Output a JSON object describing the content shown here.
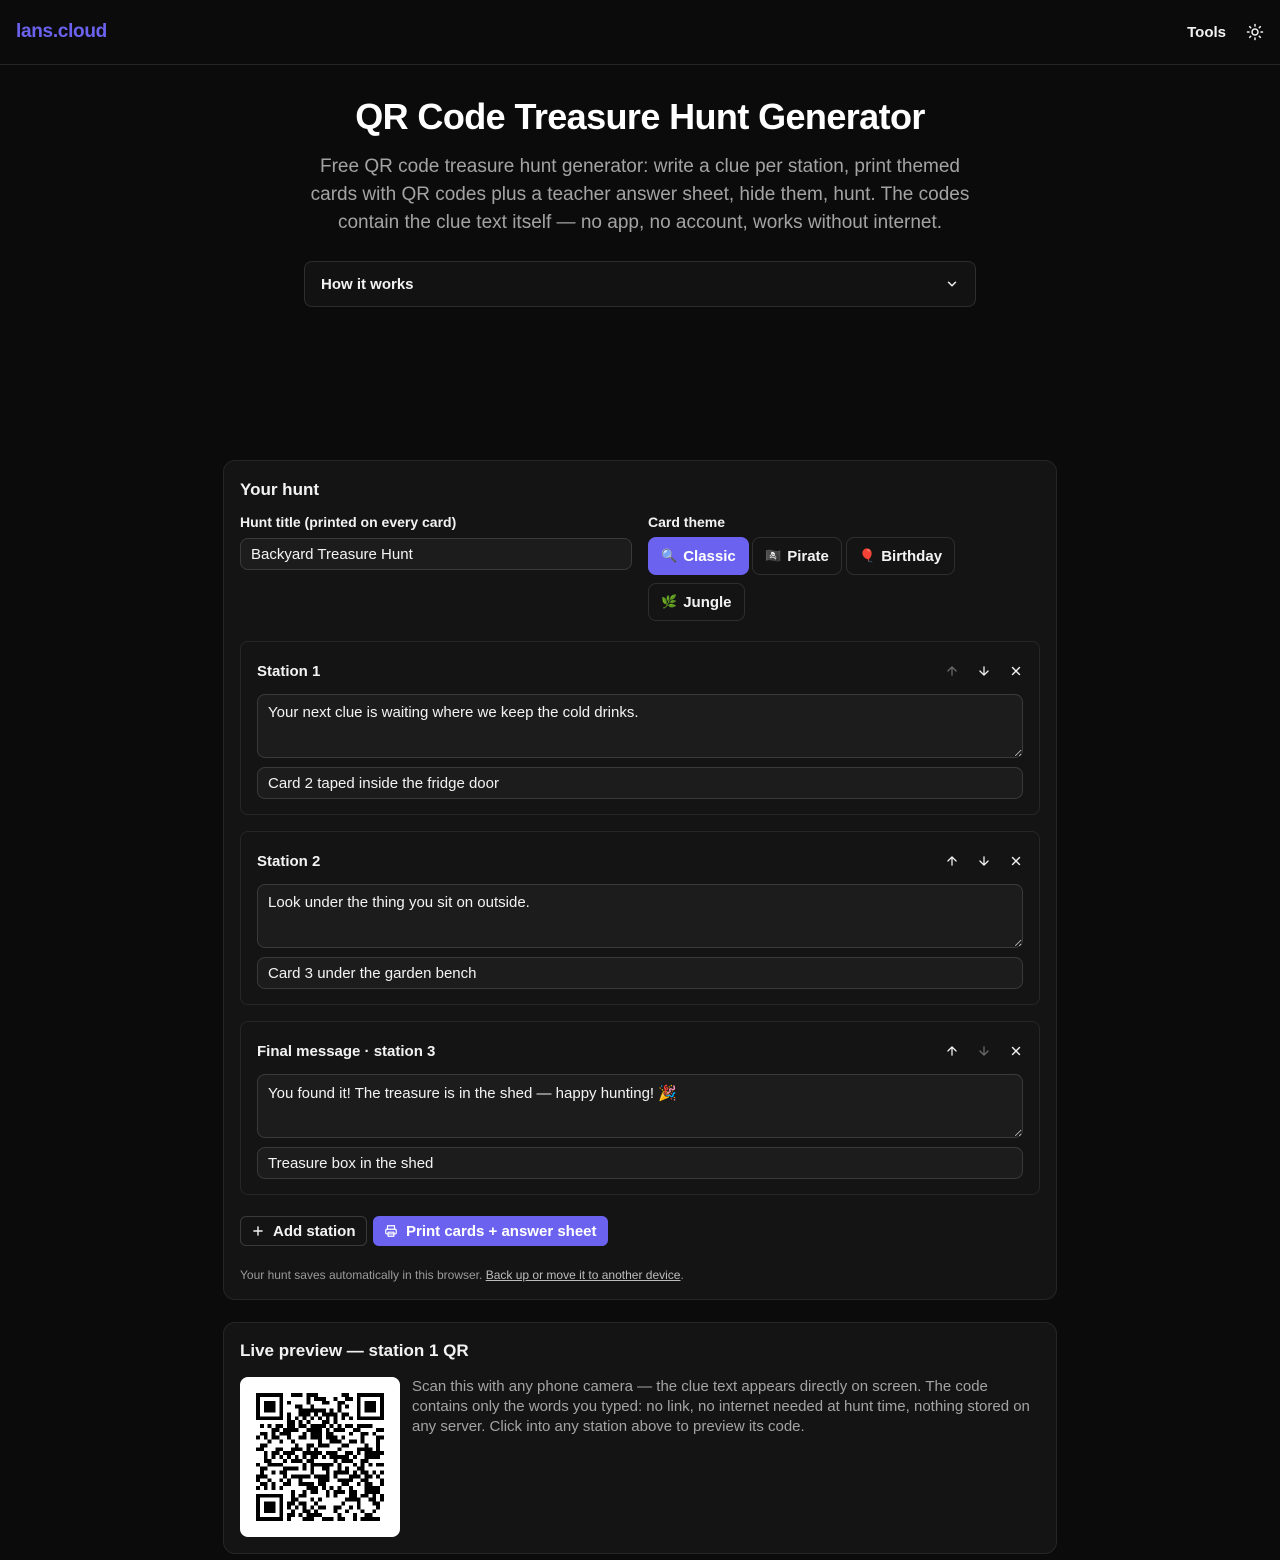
{
  "header": {
    "logo": "lans.cloud",
    "nav_tools": "Tools"
  },
  "hero": {
    "title": "QR Code Treasure Hunt Generator",
    "description": "Free QR code treasure hunt generator: write a clue per station, print themed cards with QR codes plus a teacher answer sheet, hide them, hunt. The codes contain the clue text itself — no app, no account, works without internet.",
    "how_it_works": "How it works"
  },
  "hunt": {
    "title": "Your hunt",
    "title_label": "Hunt title (printed on every card)",
    "title_value": "Backyard Treasure Hunt",
    "theme_label": "Card theme",
    "themes": [
      {
        "emoji": "🔍",
        "label": "Classic",
        "active": true
      },
      {
        "emoji": "🏴‍☠️",
        "label": "Pirate",
        "active": false
      },
      {
        "emoji": "🎈",
        "label": "Birthday",
        "active": false
      },
      {
        "emoji": "🌿",
        "label": "Jungle",
        "active": false
      }
    ],
    "stations": [
      {
        "title": "Station 1",
        "clue": "Your next clue is waiting where we keep the cold drinks.",
        "hiding_place": "Card 2 taped inside the fridge door"
      },
      {
        "title": "Station 2",
        "clue": "Look under the thing you sit on outside.",
        "hiding_place": "Card 3 under the garden bench"
      },
      {
        "title": "Final message · station 3",
        "clue": "You found it! The treasure is in the shed — happy hunting! 🎉",
        "hiding_place": "Treasure box in the shed"
      }
    ],
    "add_station": "Add station",
    "print": "Print cards + answer sheet",
    "save_note": "Your hunt saves automatically in this browser.",
    "save_link": "Back up or move it to another device",
    "save_period": "."
  },
  "preview": {
    "title": "Live preview — station 1 QR",
    "description": "Scan this with any phone camera — the clue text appears directly on screen. The code contains only the words you typed: no link, no internet needed at hunt time, nothing stored on any server. Click into any station above to preview its code."
  },
  "colors": {
    "accent": "#6b63f0",
    "background": "#0b0b0b",
    "card": "#141414"
  }
}
